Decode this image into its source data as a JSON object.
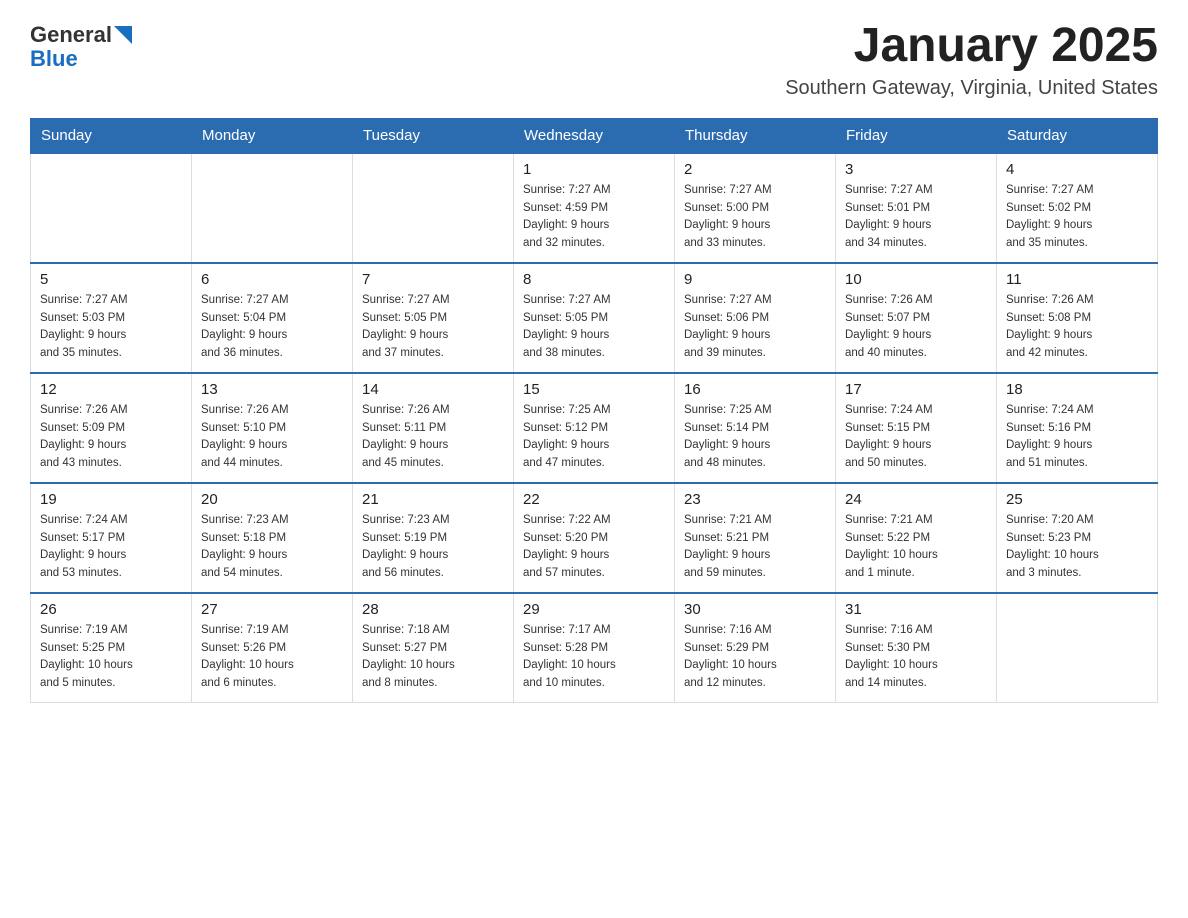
{
  "header": {
    "logo_general": "General",
    "logo_blue": "Blue",
    "title": "January 2025",
    "location": "Southern Gateway, Virginia, United States"
  },
  "days_of_week": [
    "Sunday",
    "Monday",
    "Tuesday",
    "Wednesday",
    "Thursday",
    "Friday",
    "Saturday"
  ],
  "weeks": [
    [
      {
        "day": "",
        "info": ""
      },
      {
        "day": "",
        "info": ""
      },
      {
        "day": "",
        "info": ""
      },
      {
        "day": "1",
        "info": "Sunrise: 7:27 AM\nSunset: 4:59 PM\nDaylight: 9 hours\nand 32 minutes."
      },
      {
        "day": "2",
        "info": "Sunrise: 7:27 AM\nSunset: 5:00 PM\nDaylight: 9 hours\nand 33 minutes."
      },
      {
        "day": "3",
        "info": "Sunrise: 7:27 AM\nSunset: 5:01 PM\nDaylight: 9 hours\nand 34 minutes."
      },
      {
        "day": "4",
        "info": "Sunrise: 7:27 AM\nSunset: 5:02 PM\nDaylight: 9 hours\nand 35 minutes."
      }
    ],
    [
      {
        "day": "5",
        "info": "Sunrise: 7:27 AM\nSunset: 5:03 PM\nDaylight: 9 hours\nand 35 minutes."
      },
      {
        "day": "6",
        "info": "Sunrise: 7:27 AM\nSunset: 5:04 PM\nDaylight: 9 hours\nand 36 minutes."
      },
      {
        "day": "7",
        "info": "Sunrise: 7:27 AM\nSunset: 5:05 PM\nDaylight: 9 hours\nand 37 minutes."
      },
      {
        "day": "8",
        "info": "Sunrise: 7:27 AM\nSunset: 5:05 PM\nDaylight: 9 hours\nand 38 minutes."
      },
      {
        "day": "9",
        "info": "Sunrise: 7:27 AM\nSunset: 5:06 PM\nDaylight: 9 hours\nand 39 minutes."
      },
      {
        "day": "10",
        "info": "Sunrise: 7:26 AM\nSunset: 5:07 PM\nDaylight: 9 hours\nand 40 minutes."
      },
      {
        "day": "11",
        "info": "Sunrise: 7:26 AM\nSunset: 5:08 PM\nDaylight: 9 hours\nand 42 minutes."
      }
    ],
    [
      {
        "day": "12",
        "info": "Sunrise: 7:26 AM\nSunset: 5:09 PM\nDaylight: 9 hours\nand 43 minutes."
      },
      {
        "day": "13",
        "info": "Sunrise: 7:26 AM\nSunset: 5:10 PM\nDaylight: 9 hours\nand 44 minutes."
      },
      {
        "day": "14",
        "info": "Sunrise: 7:26 AM\nSunset: 5:11 PM\nDaylight: 9 hours\nand 45 minutes."
      },
      {
        "day": "15",
        "info": "Sunrise: 7:25 AM\nSunset: 5:12 PM\nDaylight: 9 hours\nand 47 minutes."
      },
      {
        "day": "16",
        "info": "Sunrise: 7:25 AM\nSunset: 5:14 PM\nDaylight: 9 hours\nand 48 minutes."
      },
      {
        "day": "17",
        "info": "Sunrise: 7:24 AM\nSunset: 5:15 PM\nDaylight: 9 hours\nand 50 minutes."
      },
      {
        "day": "18",
        "info": "Sunrise: 7:24 AM\nSunset: 5:16 PM\nDaylight: 9 hours\nand 51 minutes."
      }
    ],
    [
      {
        "day": "19",
        "info": "Sunrise: 7:24 AM\nSunset: 5:17 PM\nDaylight: 9 hours\nand 53 minutes."
      },
      {
        "day": "20",
        "info": "Sunrise: 7:23 AM\nSunset: 5:18 PM\nDaylight: 9 hours\nand 54 minutes."
      },
      {
        "day": "21",
        "info": "Sunrise: 7:23 AM\nSunset: 5:19 PM\nDaylight: 9 hours\nand 56 minutes."
      },
      {
        "day": "22",
        "info": "Sunrise: 7:22 AM\nSunset: 5:20 PM\nDaylight: 9 hours\nand 57 minutes."
      },
      {
        "day": "23",
        "info": "Sunrise: 7:21 AM\nSunset: 5:21 PM\nDaylight: 9 hours\nand 59 minutes."
      },
      {
        "day": "24",
        "info": "Sunrise: 7:21 AM\nSunset: 5:22 PM\nDaylight: 10 hours\nand 1 minute."
      },
      {
        "day": "25",
        "info": "Sunrise: 7:20 AM\nSunset: 5:23 PM\nDaylight: 10 hours\nand 3 minutes."
      }
    ],
    [
      {
        "day": "26",
        "info": "Sunrise: 7:19 AM\nSunset: 5:25 PM\nDaylight: 10 hours\nand 5 minutes."
      },
      {
        "day": "27",
        "info": "Sunrise: 7:19 AM\nSunset: 5:26 PM\nDaylight: 10 hours\nand 6 minutes."
      },
      {
        "day": "28",
        "info": "Sunrise: 7:18 AM\nSunset: 5:27 PM\nDaylight: 10 hours\nand 8 minutes."
      },
      {
        "day": "29",
        "info": "Sunrise: 7:17 AM\nSunset: 5:28 PM\nDaylight: 10 hours\nand 10 minutes."
      },
      {
        "day": "30",
        "info": "Sunrise: 7:16 AM\nSunset: 5:29 PM\nDaylight: 10 hours\nand 12 minutes."
      },
      {
        "day": "31",
        "info": "Sunrise: 7:16 AM\nSunset: 5:30 PM\nDaylight: 10 hours\nand 14 minutes."
      },
      {
        "day": "",
        "info": ""
      }
    ]
  ]
}
